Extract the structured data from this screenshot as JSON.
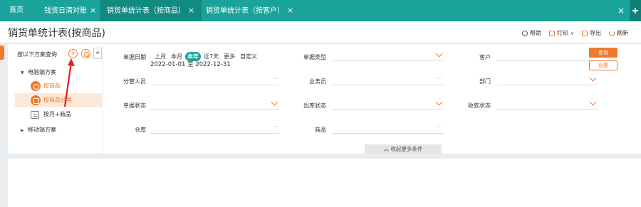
{
  "tabs": [
    {
      "label": "首页"
    },
    {
      "label": "钱货日清对账",
      "close": "×"
    },
    {
      "label": "销货单统计表（按商品）",
      "close": "×"
    },
    {
      "label": "销货单统计表（按客户）",
      "close": "×"
    }
  ],
  "tabbar_close": "×",
  "page_title": "销货单统计表(按商品)",
  "actions": {
    "help": "帮助",
    "print": "打印",
    "export": "导出",
    "refresh": "刷新"
  },
  "sidebar": {
    "heading": "按以下方案查询",
    "add_symbol": "+",
    "collapse_symbol": "«",
    "groups": [
      {
        "label": "电脑端方案",
        "caret": "▼"
      },
      {
        "label": "移动端方案",
        "caret": "▶"
      }
    ],
    "items": [
      {
        "label": "按商品"
      },
      {
        "label": "按商品分类"
      },
      {
        "label": "按月+商品"
      }
    ]
  },
  "filters": {
    "doc_date_label": "单据日期",
    "date_chips": [
      "上月",
      "本月",
      "本年",
      "近7天",
      "更多",
      "自定义"
    ],
    "date_range": "2022-01-01 至 2022-12-31",
    "doc_type_label": "单据类型",
    "customer_label": "客户",
    "manager_label": "分管人员",
    "salesman_label": "业务员",
    "dept_label": "部门",
    "doc_status_label": "单据状态",
    "outbound_status_label": "出库状态",
    "payment_status_label": "收款状态",
    "warehouse_label": "仓库",
    "product_label": "商品",
    "ellipsis": "···"
  },
  "buttons": {
    "query": "查询",
    "reset": "设置"
  },
  "more_conditions": "收起更多条件",
  "more_conditions_icon": "︽",
  "colors": {
    "teal": "#1aa39a",
    "orange": "#f07a2a",
    "red_annotation": "#e02020"
  }
}
